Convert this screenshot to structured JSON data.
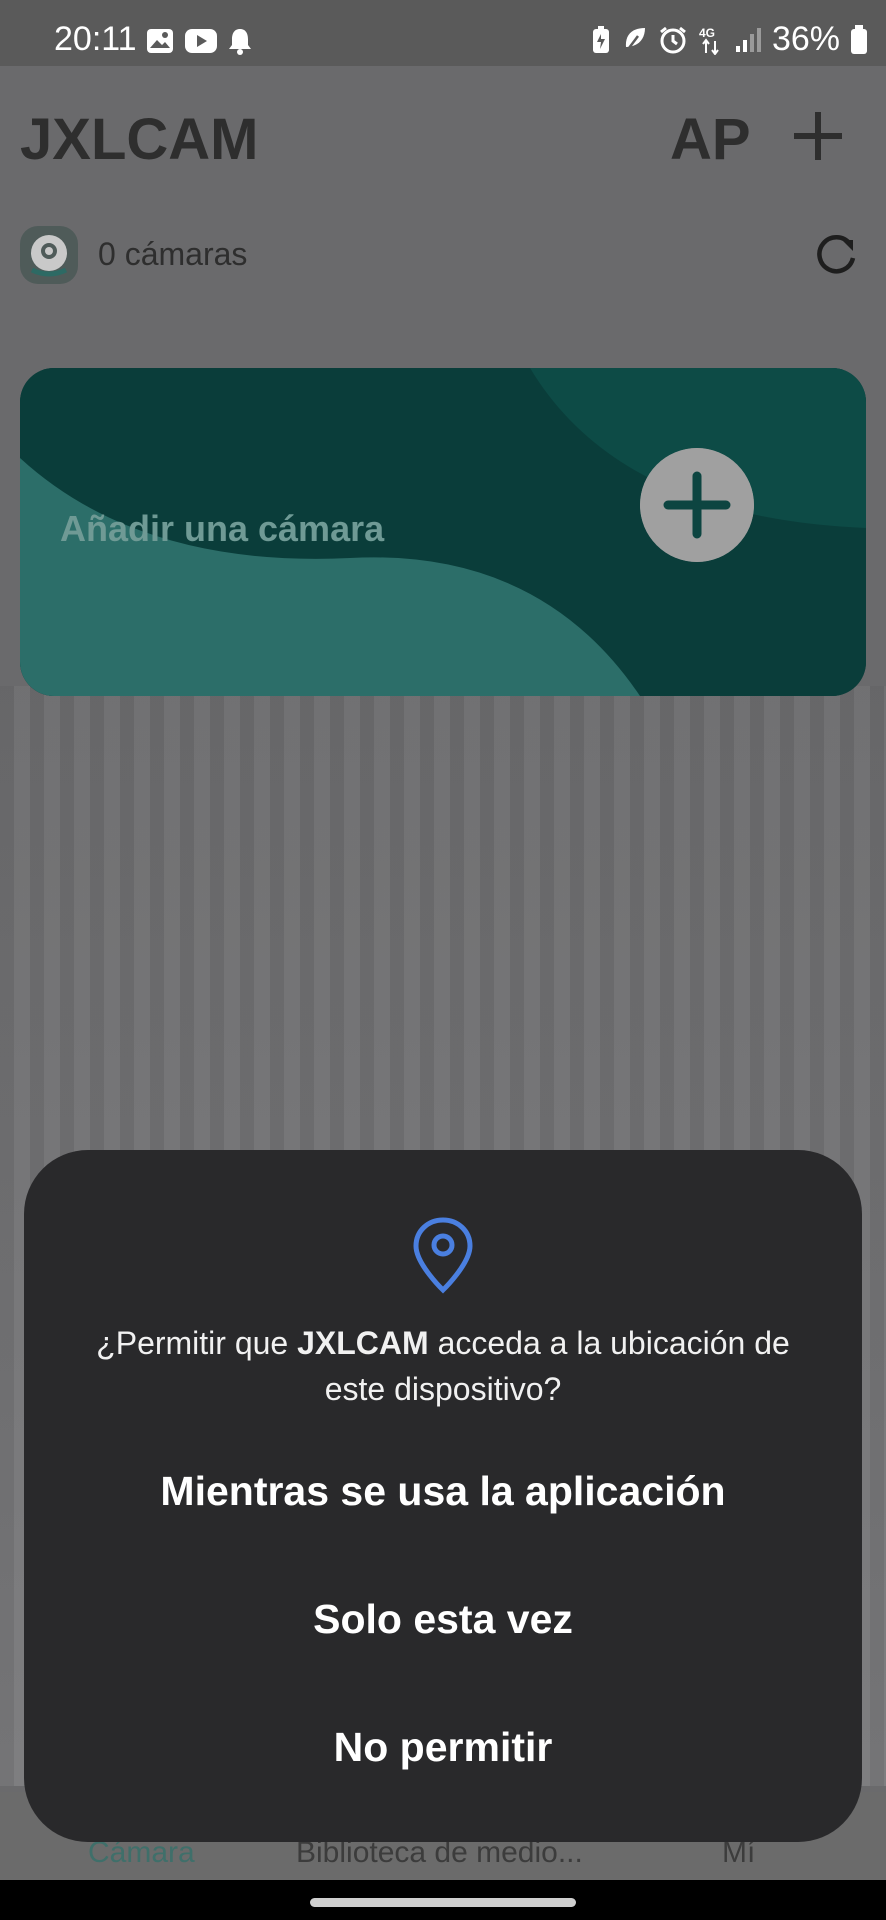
{
  "status_bar": {
    "time": "20:11",
    "left_icons": [
      "gallery-icon",
      "youtube-icon",
      "notification-bell-icon"
    ],
    "right_icons": [
      "battery-saver-icon",
      "leaf-icon",
      "alarm-icon",
      "network-4g-icon",
      "signal-icon"
    ],
    "battery_percent": "36%"
  },
  "app": {
    "title": "JXLCAM",
    "ap_label": "AP",
    "camera_count": "0 cámaras",
    "add_card_label": "Añadir una cámara",
    "colors": {
      "accent": "#0b5e57",
      "card_light": "#2d8a82"
    }
  },
  "bottom_nav": {
    "items": [
      {
        "label": "Cámara"
      },
      {
        "label": "Biblioteca de medio..."
      },
      {
        "label": "Mí"
      }
    ]
  },
  "dialog": {
    "question_prefix": "¿Permitir que ",
    "app_name": "JXLCAM",
    "question_suffix": " acceda a la ubicación de este dispositivo?",
    "options": [
      "Mientras se usa la aplicación",
      "Solo esta vez",
      "No permitir"
    ],
    "icon": "location-pin-icon",
    "icon_color": "#4a7fe0"
  }
}
